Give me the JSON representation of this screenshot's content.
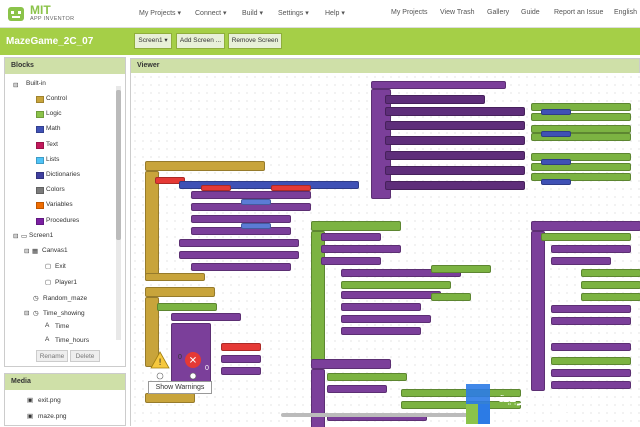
{
  "brand": {
    "logo_top": "MIT",
    "logo_bottom": "APP INVENTOR",
    "accent": "#8bc34a"
  },
  "topnav": {
    "left_items": [
      "My Projects ▾",
      "Connect ▾",
      "Build ▾",
      "Settings ▾",
      "Help ▾"
    ],
    "right_items": [
      "My Projects",
      "View Trash",
      "Gallery",
      "Guide",
      "Report an Issue",
      "English"
    ]
  },
  "project": {
    "title": "MazeGame_2C_07",
    "screen_select": "Screen1 ▾",
    "add_screen": "Add Screen ...",
    "remove_screen": "Remove Screen"
  },
  "blocks_panel": {
    "heading": "Blocks",
    "builtin_label": "Built-in",
    "builtin": [
      {
        "label": "Control",
        "color": "#c8a43b"
      },
      {
        "label": "Logic",
        "color": "#8bc34a"
      },
      {
        "label": "Math",
        "color": "#3f51b5"
      },
      {
        "label": "Text",
        "color": "#c2185b"
      },
      {
        "label": "Lists",
        "color": "#4fc3f7"
      },
      {
        "label": "Dictionaries",
        "color": "#3f3f9f"
      },
      {
        "label": "Colors",
        "color": "#7b7b7b"
      },
      {
        "label": "Variables",
        "color": "#ef6c00"
      },
      {
        "label": "Procedures",
        "color": "#7b1fa2"
      }
    ],
    "screen": "Screen1",
    "components": [
      {
        "label": "Canvas1",
        "level": 2
      },
      {
        "label": "Exit",
        "level": 3
      },
      {
        "label": "Player1",
        "level": 3
      },
      {
        "label": "Random_maze",
        "level": 2
      },
      {
        "label": "Time_showing",
        "level": 2
      },
      {
        "label": "Time",
        "level": 3
      },
      {
        "label": "Time_hours",
        "level": 3
      }
    ],
    "rename": "Rename",
    "delete": "Delete"
  },
  "media_panel": {
    "heading": "Media",
    "files": [
      "exit.png",
      "maze.png"
    ]
  },
  "viewer": {
    "heading": "Viewer",
    "show_warnings": "Show Warnings",
    "warning_count": "0",
    "error_count": "0"
  },
  "watermark": {
    "arabic": "البوابة العربية",
    "english": "Arab Portal"
  }
}
